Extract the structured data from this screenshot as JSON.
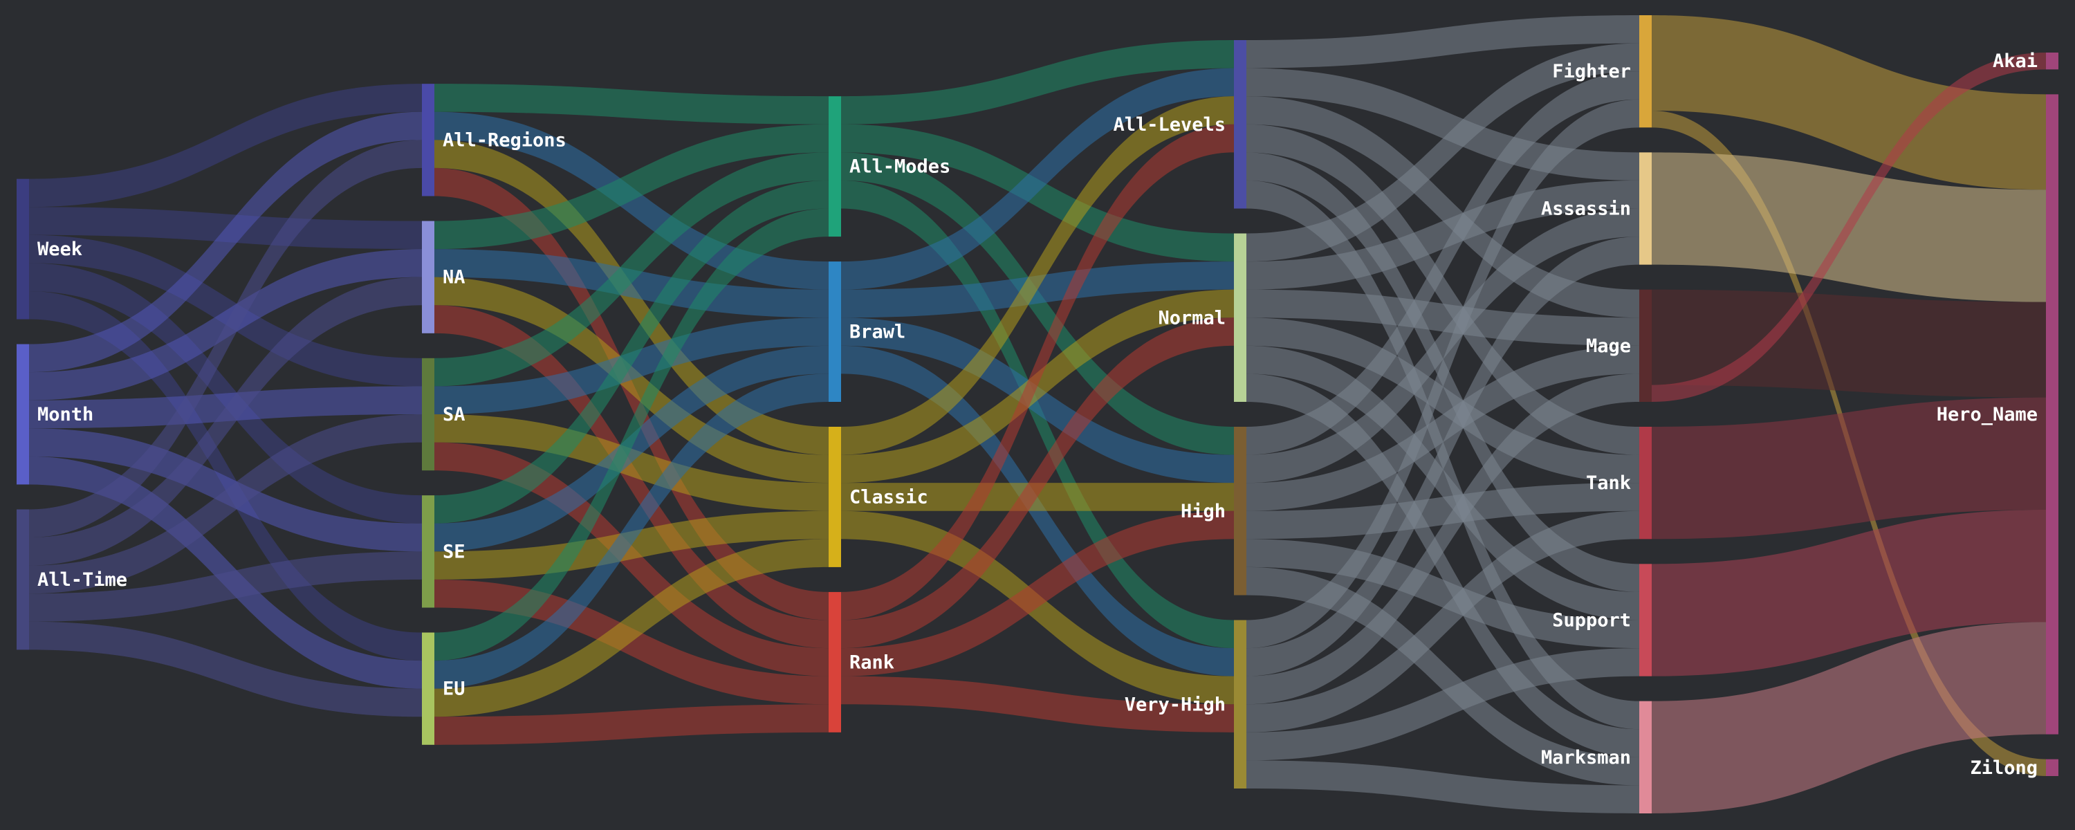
{
  "diagram": {
    "type": "sankey",
    "background": "#2b2d31",
    "columns": [
      {
        "nodes": [
          {
            "id": "week",
            "label": "Week",
            "color": "#3b3d80"
          },
          {
            "id": "month",
            "label": "Month",
            "color": "#5a5fc8"
          },
          {
            "id": "alltime",
            "label": "All-Time",
            "color": "#45477e"
          }
        ]
      },
      {
        "nodes": [
          {
            "id": "allregions",
            "label": "All-Regions",
            "color": "#4a4aa8"
          },
          {
            "id": "na",
            "label": "NA",
            "color": "#8a8fd8"
          },
          {
            "id": "sa",
            "label": "SA",
            "color": "#5e7a3c"
          },
          {
            "id": "se",
            "label": "SE",
            "color": "#7e9e4a"
          },
          {
            "id": "eu",
            "label": "EU",
            "color": "#a8c460"
          }
        ]
      },
      {
        "nodes": [
          {
            "id": "allmodes",
            "label": "All-Modes",
            "color": "#1fa37a"
          },
          {
            "id": "brawl",
            "label": "Brawl",
            "color": "#2e86c4"
          },
          {
            "id": "classic",
            "label": "Classic",
            "color": "#d6b01a"
          },
          {
            "id": "rank",
            "label": "Rank",
            "color": "#d9433a"
          }
        ]
      },
      {
        "nodes": [
          {
            "id": "alllevels",
            "label": "All-Levels",
            "color": "#4c4ea4"
          },
          {
            "id": "normal",
            "label": "Normal",
            "color": "#b6d196"
          },
          {
            "id": "high",
            "label": "High",
            "color": "#7b5e32"
          },
          {
            "id": "veryhigh",
            "label": "Very-High",
            "color": "#9a8a34"
          }
        ]
      },
      {
        "nodes": [
          {
            "id": "fighter",
            "label": "Fighter",
            "color": "#d9a63a"
          },
          {
            "id": "assassin",
            "label": "Assassin",
            "color": "#e6c888"
          },
          {
            "id": "mage",
            "label": "Mage",
            "color": "#5a2c2e"
          },
          {
            "id": "tank",
            "label": "Tank",
            "color": "#b03a48"
          },
          {
            "id": "support",
            "label": "Support",
            "color": "#c84a58"
          },
          {
            "id": "marksman",
            "label": "Marksman",
            "color": "#e08a98"
          }
        ]
      },
      {
        "nodes": [
          {
            "id": "akai",
            "label": "Akai",
            "color": "#a0457a"
          },
          {
            "id": "heroname",
            "label": "Hero_Name",
            "color": "#a0457a"
          },
          {
            "id": "zilong",
            "label": "Zilong",
            "color": "#a0457a"
          }
        ]
      }
    ],
    "links": [
      {
        "source": "week",
        "target": "allregions",
        "value": 1,
        "color": "#3d3f82"
      },
      {
        "source": "week",
        "target": "na",
        "value": 1,
        "color": "#3d3f82"
      },
      {
        "source": "week",
        "target": "sa",
        "value": 1,
        "color": "#3d3f82"
      },
      {
        "source": "week",
        "target": "se",
        "value": 1,
        "color": "#3d3f82"
      },
      {
        "source": "week",
        "target": "eu",
        "value": 1,
        "color": "#3d3f82"
      },
      {
        "source": "month",
        "target": "allregions",
        "value": 1,
        "color": "#5257b6"
      },
      {
        "source": "month",
        "target": "na",
        "value": 1,
        "color": "#5257b6"
      },
      {
        "source": "month",
        "target": "sa",
        "value": 1,
        "color": "#5257b6"
      },
      {
        "source": "month",
        "target": "se",
        "value": 1,
        "color": "#5257b6"
      },
      {
        "source": "month",
        "target": "eu",
        "value": 1,
        "color": "#5257b6"
      },
      {
        "source": "alltime",
        "target": "allregions",
        "value": 1,
        "color": "#4a4c8c"
      },
      {
        "source": "alltime",
        "target": "na",
        "value": 1,
        "color": "#4a4c8c"
      },
      {
        "source": "alltime",
        "target": "sa",
        "value": 1,
        "color": "#4a4c8c"
      },
      {
        "source": "alltime",
        "target": "se",
        "value": 1,
        "color": "#4a4c8c"
      },
      {
        "source": "alltime",
        "target": "eu",
        "value": 1,
        "color": "#4a4c8c"
      },
      {
        "source": "allregions",
        "target": "allmodes",
        "value": 1,
        "color": "#1f8a66"
      },
      {
        "source": "allregions",
        "target": "brawl",
        "value": 1,
        "color": "#2e6fa6"
      },
      {
        "source": "allregions",
        "target": "classic",
        "value": 1,
        "color": "#b09a1c"
      },
      {
        "source": "allregions",
        "target": "rank",
        "value": 1,
        "color": "#b23a32"
      },
      {
        "source": "na",
        "target": "allmodes",
        "value": 1,
        "color": "#1f8a66"
      },
      {
        "source": "na",
        "target": "brawl",
        "value": 1,
        "color": "#2e6fa6"
      },
      {
        "source": "na",
        "target": "classic",
        "value": 1,
        "color": "#b09a1c"
      },
      {
        "source": "na",
        "target": "rank",
        "value": 1,
        "color": "#b23a32"
      },
      {
        "source": "sa",
        "target": "allmodes",
        "value": 1,
        "color": "#1f8a66"
      },
      {
        "source": "sa",
        "target": "brawl",
        "value": 1,
        "color": "#2e6fa6"
      },
      {
        "source": "sa",
        "target": "classic",
        "value": 1,
        "color": "#b09a1c"
      },
      {
        "source": "sa",
        "target": "rank",
        "value": 1,
        "color": "#b23a32"
      },
      {
        "source": "se",
        "target": "allmodes",
        "value": 1,
        "color": "#1f8a66"
      },
      {
        "source": "se",
        "target": "brawl",
        "value": 1,
        "color": "#2e6fa6"
      },
      {
        "source": "se",
        "target": "classic",
        "value": 1,
        "color": "#b09a1c"
      },
      {
        "source": "se",
        "target": "rank",
        "value": 1,
        "color": "#b23a32"
      },
      {
        "source": "eu",
        "target": "allmodes",
        "value": 1,
        "color": "#1f8a66"
      },
      {
        "source": "eu",
        "target": "brawl",
        "value": 1,
        "color": "#2e6fa6"
      },
      {
        "source": "eu",
        "target": "classic",
        "value": 1,
        "color": "#b09a1c"
      },
      {
        "source": "eu",
        "target": "rank",
        "value": 1,
        "color": "#b23a32"
      },
      {
        "source": "allmodes",
        "target": "alllevels",
        "value": 1,
        "color": "#1f8a66"
      },
      {
        "source": "allmodes",
        "target": "normal",
        "value": 1,
        "color": "#1f8a66"
      },
      {
        "source": "allmodes",
        "target": "high",
        "value": 1,
        "color": "#1f8a66"
      },
      {
        "source": "allmodes",
        "target": "veryhigh",
        "value": 1,
        "color": "#1f8a66"
      },
      {
        "source": "brawl",
        "target": "alllevels",
        "value": 1,
        "color": "#2e6fa6"
      },
      {
        "source": "brawl",
        "target": "normal",
        "value": 1,
        "color": "#2e6fa6"
      },
      {
        "source": "brawl",
        "target": "high",
        "value": 1,
        "color": "#2e6fa6"
      },
      {
        "source": "brawl",
        "target": "veryhigh",
        "value": 1,
        "color": "#2e6fa6"
      },
      {
        "source": "classic",
        "target": "alllevels",
        "value": 1,
        "color": "#b09a1c"
      },
      {
        "source": "classic",
        "target": "normal",
        "value": 1,
        "color": "#b09a1c"
      },
      {
        "source": "classic",
        "target": "high",
        "value": 1,
        "color": "#b09a1c"
      },
      {
        "source": "classic",
        "target": "veryhigh",
        "value": 1,
        "color": "#b09a1c"
      },
      {
        "source": "rank",
        "target": "alllevels",
        "value": 1,
        "color": "#b23a32"
      },
      {
        "source": "rank",
        "target": "normal",
        "value": 1,
        "color": "#b23a32"
      },
      {
        "source": "rank",
        "target": "high",
        "value": 1,
        "color": "#b23a32"
      },
      {
        "source": "rank",
        "target": "veryhigh",
        "value": 1,
        "color": "#b23a32"
      },
      {
        "source": "alllevels",
        "target": "fighter",
        "value": 1,
        "color": "#7c8590"
      },
      {
        "source": "alllevels",
        "target": "assassin",
        "value": 1,
        "color": "#7c8590"
      },
      {
        "source": "alllevels",
        "target": "mage",
        "value": 1,
        "color": "#7c8590"
      },
      {
        "source": "alllevels",
        "target": "tank",
        "value": 1,
        "color": "#7c8590"
      },
      {
        "source": "alllevels",
        "target": "support",
        "value": 1,
        "color": "#7c8590"
      },
      {
        "source": "alllevels",
        "target": "marksman",
        "value": 1,
        "color": "#7c8590"
      },
      {
        "source": "normal",
        "target": "fighter",
        "value": 1,
        "color": "#7c8590"
      },
      {
        "source": "normal",
        "target": "assassin",
        "value": 1,
        "color": "#7c8590"
      },
      {
        "source": "normal",
        "target": "mage",
        "value": 1,
        "color": "#7c8590"
      },
      {
        "source": "normal",
        "target": "tank",
        "value": 1,
        "color": "#7c8590"
      },
      {
        "source": "normal",
        "target": "support",
        "value": 1,
        "color": "#7c8590"
      },
      {
        "source": "normal",
        "target": "marksman",
        "value": 1,
        "color": "#7c8590"
      },
      {
        "source": "high",
        "target": "fighter",
        "value": 1,
        "color": "#7c8590"
      },
      {
        "source": "high",
        "target": "assassin",
        "value": 1,
        "color": "#7c8590"
      },
      {
        "source": "high",
        "target": "mage",
        "value": 1,
        "color": "#7c8590"
      },
      {
        "source": "high",
        "target": "tank",
        "value": 1,
        "color": "#7c8590"
      },
      {
        "source": "high",
        "target": "support",
        "value": 1,
        "color": "#7c8590"
      },
      {
        "source": "high",
        "target": "marksman",
        "value": 1,
        "color": "#7c8590"
      },
      {
        "source": "veryhigh",
        "target": "fighter",
        "value": 1,
        "color": "#7c8590"
      },
      {
        "source": "veryhigh",
        "target": "assassin",
        "value": 1,
        "color": "#7c8590"
      },
      {
        "source": "veryhigh",
        "target": "mage",
        "value": 1,
        "color": "#7c8590"
      },
      {
        "source": "veryhigh",
        "target": "tank",
        "value": 1,
        "color": "#7c8590"
      },
      {
        "source": "veryhigh",
        "target": "support",
        "value": 1,
        "color": "#7c8590"
      },
      {
        "source": "veryhigh",
        "target": "marksman",
        "value": 1,
        "color": "#7c8590"
      },
      {
        "source": "fighter",
        "target": "heroname",
        "value": 3.4,
        "color": "#c09a3a"
      },
      {
        "source": "fighter",
        "target": "zilong",
        "value": 0.6,
        "color": "#c09a3a"
      },
      {
        "source": "assassin",
        "target": "heroname",
        "value": 4,
        "color": "#d4bc88"
      },
      {
        "source": "mage",
        "target": "heroname",
        "value": 3.4,
        "color": "#5a2c2e"
      },
      {
        "source": "mage",
        "target": "akai",
        "value": 0.6,
        "color": "#b03a48"
      },
      {
        "source": "tank",
        "target": "heroname",
        "value": 4,
        "color": "#8a3442"
      },
      {
        "source": "support",
        "target": "heroname",
        "value": 4,
        "color": "#a84052"
      },
      {
        "source": "marksman",
        "target": "heroname",
        "value": 4,
        "color": "#c27882"
      }
    ]
  }
}
